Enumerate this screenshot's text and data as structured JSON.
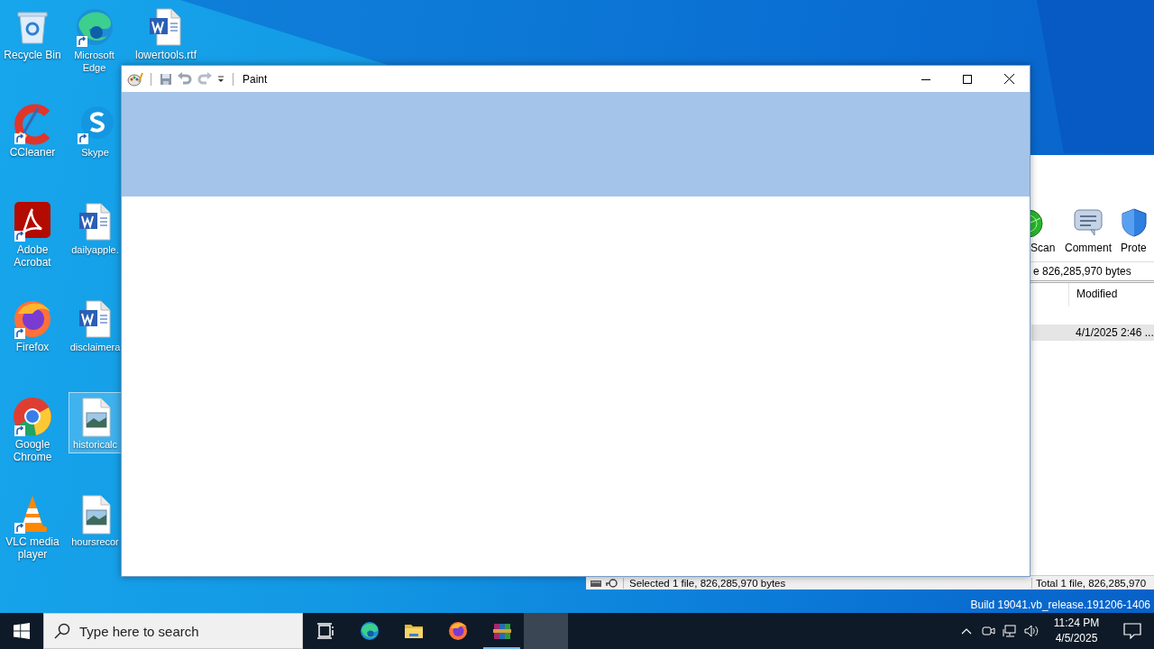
{
  "desktop": {
    "icons": [
      {
        "label": "Recycle Bin",
        "kind": "recycle-bin",
        "shortcut": false,
        "selected": false
      },
      {
        "label": "CCleaner",
        "kind": "ccleaner",
        "shortcut": true,
        "selected": false
      },
      {
        "label": "Adobe Acrobat",
        "kind": "acrobat",
        "shortcut": true,
        "selected": false
      },
      {
        "label": "Firefox",
        "kind": "firefox",
        "shortcut": true,
        "selected": false
      },
      {
        "label": "Google Chrome",
        "kind": "chrome",
        "shortcut": true,
        "selected": false
      },
      {
        "label": "VLC media player",
        "kind": "vlc",
        "shortcut": true,
        "selected": false
      },
      {
        "label": "Microsoft Edge",
        "kind": "edge",
        "shortcut": true,
        "selected": false
      },
      {
        "label": "Skype",
        "kind": "skype",
        "shortcut": true,
        "selected": false
      },
      {
        "label": "dailyapple.",
        "kind": "word",
        "shortcut": false,
        "selected": false
      },
      {
        "label": "disclaimera",
        "kind": "word",
        "shortcut": false,
        "selected": false
      },
      {
        "label": "historicalc",
        "kind": "image",
        "shortcut": false,
        "selected": true
      },
      {
        "label": "hoursrecor",
        "kind": "image",
        "shortcut": false,
        "selected": false
      },
      {
        "label": "lowertools.rtf",
        "kind": "word",
        "shortcut": false,
        "selected": false
      }
    ],
    "build_text": "Build 19041.vb_release.191206-1406"
  },
  "background_window": {
    "toolbar": [
      {
        "label": "Scan",
        "kind": "scan"
      },
      {
        "label": "Comment",
        "kind": "comment"
      },
      {
        "label": "Prote",
        "kind": "protect"
      }
    ],
    "address": "e 826,285,970 bytes",
    "columns": [
      "Modified"
    ],
    "rows": [
      {
        "modified": "4/1/2025 2:46 ...",
        "selected": true
      }
    ],
    "status_left": "Selected 1 file, 826,285,970 bytes",
    "status_right": "Total 1 file, 826,285,970"
  },
  "paint_window": {
    "title": "Paint"
  },
  "taskbar": {
    "search_placeholder": "Type here to search",
    "apps": [
      {
        "kind": "task-view",
        "running": false,
        "active": false
      },
      {
        "kind": "edge",
        "running": false,
        "active": false
      },
      {
        "kind": "explorer",
        "running": false,
        "active": false
      },
      {
        "kind": "firefox",
        "running": false,
        "active": false
      },
      {
        "kind": "winrar",
        "running": true,
        "active": false
      },
      {
        "kind": "empty",
        "running": false,
        "active": true
      }
    ],
    "time": "11:24 PM",
    "date": "4/5/2025"
  }
}
